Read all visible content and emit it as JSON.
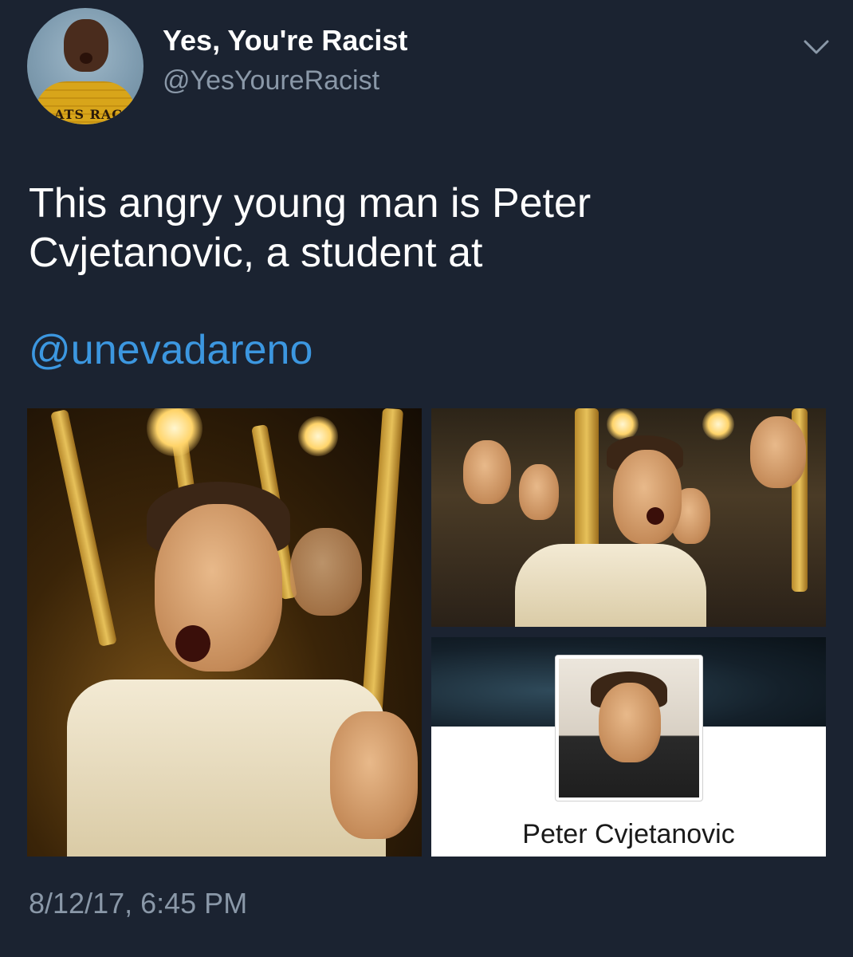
{
  "header": {
    "display_name": "Yes, You're Racist",
    "handle": "@YesYoureRacist",
    "avatar_text": "ATS RAC",
    "menu_icon": "chevron-down-icon"
  },
  "tweet": {
    "text": "This angry young man is Peter Cvjetanovic, a student at",
    "mention": "@unevadareno",
    "timestamp": "8/12/17, 6:45 PM"
  },
  "media": {
    "profile_name": "Peter Cvjetanovic"
  },
  "colors": {
    "background": "#1b2331",
    "text": "#ffffff",
    "secondary": "#8a98a8",
    "link": "#3c97e0"
  }
}
